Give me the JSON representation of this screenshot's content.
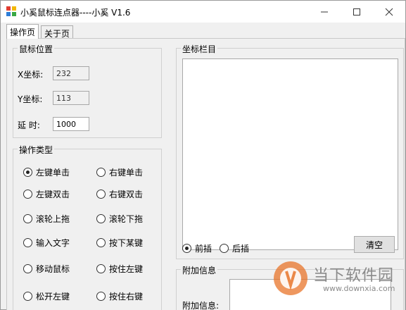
{
  "window": {
    "title": "小奚鼠标连点器----小奚 V1.6",
    "controls": {
      "minimize": "—",
      "maximize": "☐",
      "close": "✕"
    }
  },
  "tabs": [
    {
      "label": "操作页",
      "active": true
    },
    {
      "label": "关于页",
      "active": false
    }
  ],
  "mouse_position": {
    "group_title": "鼠标位置",
    "x_label": "X坐标:",
    "x_value": "232",
    "y_label": "Y坐标:",
    "y_value": "113",
    "delay_label": "延 时:",
    "delay_value": "1000"
  },
  "operation_type": {
    "group_title": "操作类型",
    "options": [
      {
        "label": "左键单击",
        "checked": true
      },
      {
        "label": "右键单击",
        "checked": false
      },
      {
        "label": "左键双击",
        "checked": false
      },
      {
        "label": "右键双击",
        "checked": false
      },
      {
        "label": "滚轮上拖",
        "checked": false
      },
      {
        "label": "滚轮下拖",
        "checked": false
      },
      {
        "label": "输入文字",
        "checked": false
      },
      {
        "label": "按下某键",
        "checked": false
      },
      {
        "label": "移动鼠标",
        "checked": false
      },
      {
        "label": "按住左键",
        "checked": false
      },
      {
        "label": "松开左键",
        "checked": false
      },
      {
        "label": "按住右键",
        "checked": false
      }
    ]
  },
  "coordinate_bar": {
    "group_title": "坐标栏目",
    "insert_before_label": "前插",
    "insert_before_checked": true,
    "insert_after_label": "后插",
    "insert_after_checked": false,
    "clear_button": "清空"
  },
  "extra_info": {
    "group_title": "附加信息",
    "field_label": "附加信息:"
  },
  "watermark": {
    "brand": "当下软件园",
    "url": "www.downxia.com"
  },
  "colors": {
    "window_bg": "#f0f0f0",
    "titlebar_bg": "#ffffff",
    "watermark_orange": "#e8742a"
  }
}
